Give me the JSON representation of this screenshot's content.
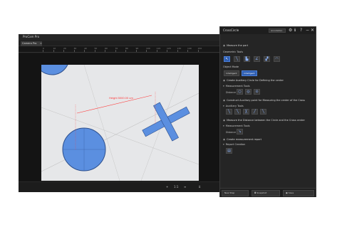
{
  "app": {
    "title": "ProCam Pro",
    "tab_label": "Camera Pro",
    "tab_close": "×",
    "ruler_ticks": [
      "0",
      "10",
      "20",
      "30",
      "40",
      "50",
      "60",
      "70",
      "80",
      "90",
      "100",
      "110",
      "120",
      "130",
      "140",
      "150"
    ]
  },
  "image": {
    "annotation_label": "Height 5000.00 um"
  },
  "statusbar": {
    "items": [
      "+",
      "1:1",
      "≡",
      "⌗"
    ]
  },
  "panel": {
    "title": "CrossCircle",
    "dropdown_value": "Annotation",
    "icons": [
      "⚙",
      "ℹ",
      "?",
      "−",
      "✕"
    ],
    "sections": {
      "measure_title": "Measure the part",
      "geometric_tools": "Geometric Tools",
      "object_mode": "Object Mode",
      "object_mode_options": [
        "Intelligent",
        "Intelligent"
      ],
      "auxiliary_circle": "Create Auxiliary Circle for Defining the center",
      "measurement_tools": "Measurement Tools",
      "distance_label": "Distance",
      "auxiliary_point": "Construct Auxiliary point for Measuring the center of the Cross",
      "auxiliary_tools": "Auxiliary Tools",
      "measure_distance": "Measure the Distance between the Circle and the Cross center",
      "measurement_tools_2": "Measurement Tools",
      "distance_label_2": "Distance",
      "create_report": "Create measurement report",
      "report_creation": "Report Creation"
    },
    "footer": {
      "left": "New Step",
      "mid": "Snapshot",
      "right": "Save"
    }
  },
  "colors": {
    "accent": "#2f5fb3",
    "annotation": "#ff3b3b",
    "blue_fill": "#5b8fe0"
  }
}
